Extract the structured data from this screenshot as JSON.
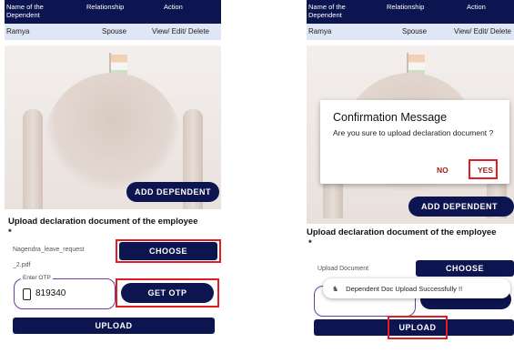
{
  "table": {
    "headers": [
      "Name of the Dependent",
      "Relationship",
      "Action"
    ],
    "row": {
      "name": "Ramya",
      "relationship": "Spouse",
      "action": "View/ Edit/ Delete"
    }
  },
  "left": {
    "add_dependent_label": "ADD DEPENDENT",
    "upload_title": "Upload declaration document of the employee",
    "required_mark": "*",
    "file_name_line1": "Nagendra_leave_request",
    "file_name_line2": "_2.pdf",
    "choose_label": "CHOOSE",
    "otp_label": "Enter OTP",
    "otp_value": "819340",
    "get_otp_label": "GET OTP",
    "upload_label": "UPLOAD"
  },
  "right": {
    "dialog": {
      "title": "Confirmation Message",
      "message": "Are you sure to upload declaration document ?",
      "no_label": "NO",
      "yes_label": "YES"
    },
    "add_dependent_label": "ADD DEPENDENT",
    "upload_title": "Upload declaration document of the employee",
    "required_mark": "*",
    "upload_document_label": "Upload Document",
    "choose_label": "CHOOSE",
    "toast_text": "Dependent Doc Upload Successfully !!",
    "upload_label": "UPLOAD"
  },
  "colors": {
    "navy": "#0d1550",
    "highlight": "#e31b23",
    "row_bg": "#dfe6f6",
    "otp_border": "#6b3fa0"
  }
}
